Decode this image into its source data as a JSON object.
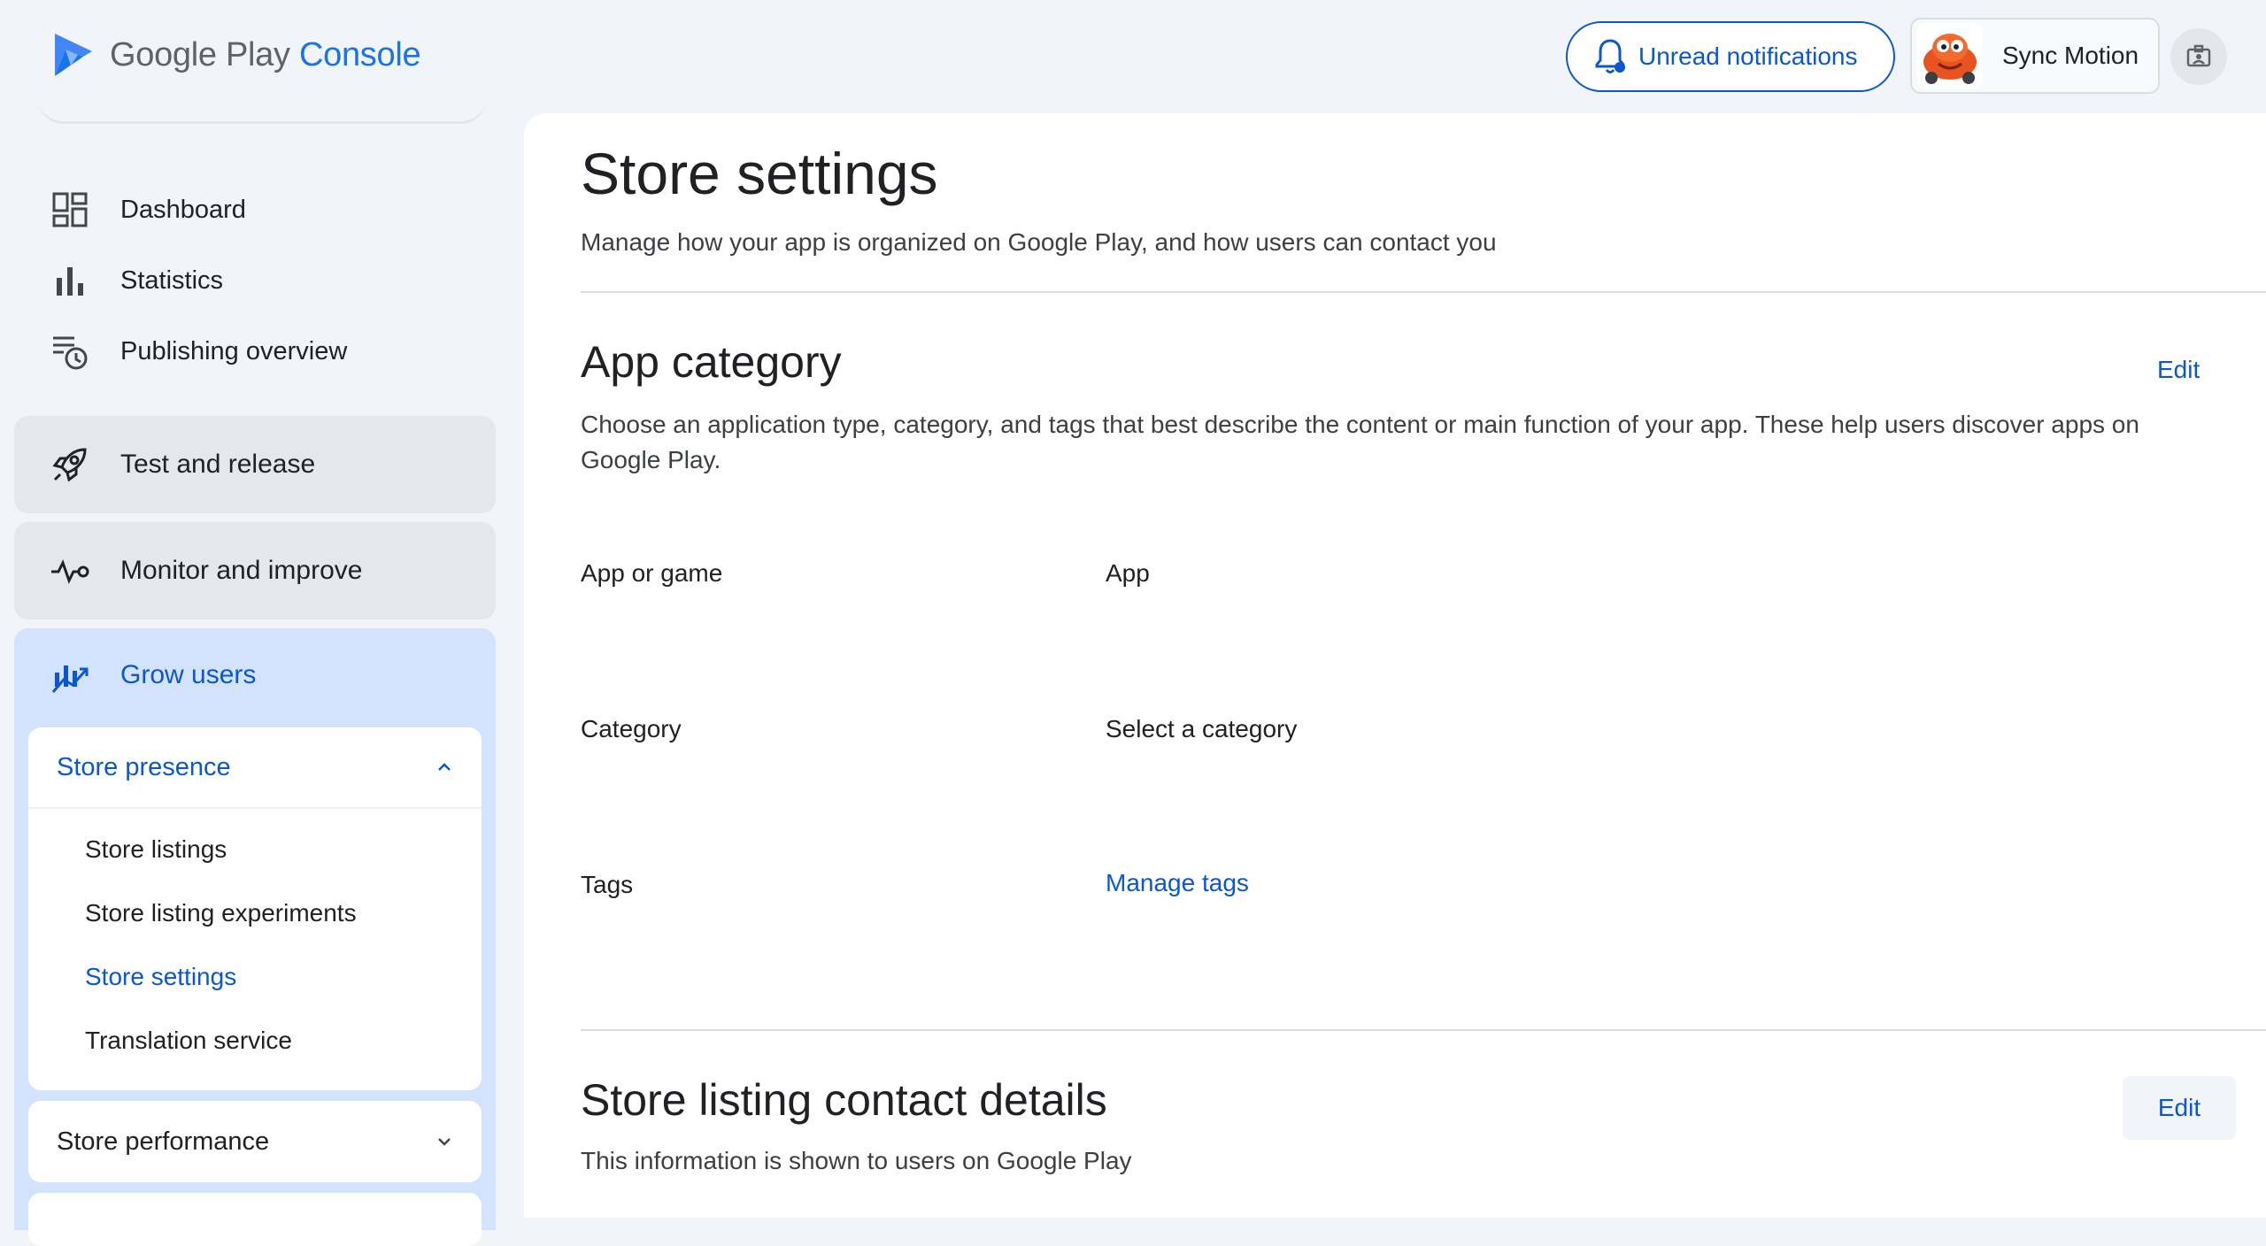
{
  "app": {
    "brand_google_play": "Google Play",
    "brand_console": "Console"
  },
  "header": {
    "notifications_label": "Unread notifications",
    "account_name": "Sync Motion",
    "notification_icon": "bell-icon",
    "settings_icon": "developer-account-icon"
  },
  "sidebar": {
    "items": [
      {
        "label": "Dashboard",
        "icon": "dashboard-icon"
      },
      {
        "label": "Statistics",
        "icon": "bar-chart-icon"
      },
      {
        "label": "Publishing overview",
        "icon": "publishing-clock-icon"
      }
    ],
    "sections": [
      {
        "label": "Test and release",
        "icon": "rocket-icon"
      },
      {
        "label": "Monitor and improve",
        "icon": "pulse-icon"
      },
      {
        "label": "Grow users",
        "icon": "growth-chart-icon"
      }
    ],
    "store_presence": {
      "label": "Store presence",
      "items": [
        "Store listings",
        "Store listing experiments",
        "Store settings",
        "Translation service"
      ],
      "selected": "Store settings"
    },
    "store_performance": {
      "label": "Store performance"
    }
  },
  "main": {
    "title": "Store settings",
    "subtitle": "Manage how your app is organized on Google Play, and how users can contact you",
    "app_category": {
      "title": "App category",
      "edit_label": "Edit",
      "description": "Choose an application type, category, and tags that best describe the content or main function of your app. These help users discover apps on Google Play.",
      "rows": [
        {
          "label": "App or game",
          "value": "App"
        },
        {
          "label": "Category",
          "value": "Select a category"
        },
        {
          "label": "Tags",
          "value": "Manage tags"
        }
      ]
    },
    "contact": {
      "title": "Store listing contact details",
      "edit_label": "Edit",
      "description": "This information is shown to users on Google Play"
    }
  }
}
